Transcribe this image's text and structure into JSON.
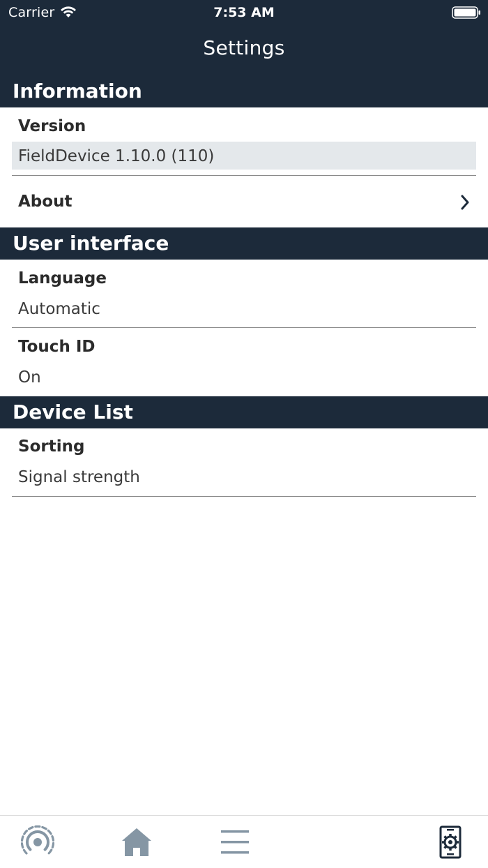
{
  "status_bar": {
    "carrier": "Carrier",
    "time": "7:53 AM"
  },
  "nav": {
    "title": "Settings"
  },
  "sections": {
    "information": {
      "header": "Information",
      "version_label": "Version",
      "version_value": "FieldDevice 1.10.0 (110)",
      "about_label": "About"
    },
    "user_interface": {
      "header": "User interface",
      "language_label": "Language",
      "language_value": "Automatic",
      "touchid_label": "Touch ID",
      "touchid_value": "On"
    },
    "device_list": {
      "header": "Device List",
      "sorting_label": "Sorting",
      "sorting_value": "Signal strength"
    }
  },
  "tabbar": {
    "items": [
      {
        "icon": "signal-icon",
        "active": false
      },
      {
        "icon": "home-icon",
        "active": false
      },
      {
        "icon": "menu-icon",
        "active": false
      },
      {
        "icon": "device-settings-icon",
        "active": true
      }
    ]
  },
  "colors": {
    "header_bg": "#1c2a3a",
    "tab_inactive": "#8596a4",
    "tab_active": "#1c2a3a",
    "value_box_bg": "#e4e8eb"
  }
}
